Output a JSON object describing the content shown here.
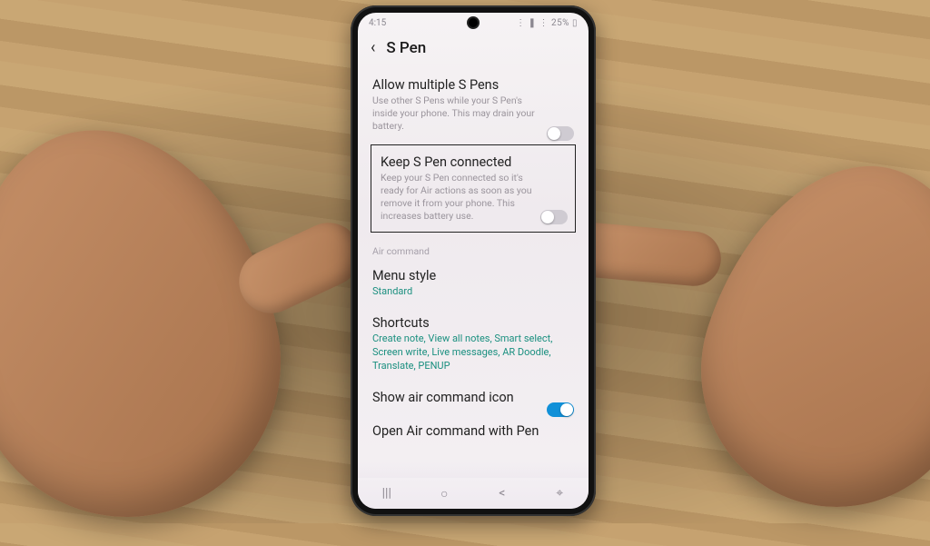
{
  "statusbar": {
    "time": "4:15",
    "right": "⋮ ❚ ⋮ 25% ▯"
  },
  "header": {
    "title": "S Pen"
  },
  "items": {
    "allow": {
      "title": "Allow multiple S Pens",
      "sub": "Use other S Pens while your S Pen's inside your phone. This may drain your battery."
    },
    "keep": {
      "title": "Keep S Pen connected",
      "sub": "Keep your S Pen connected so it's ready for Air actions as soon as you remove it from your phone. This increases battery use."
    },
    "section_air": "Air command",
    "menu": {
      "title": "Menu style",
      "value": "Standard"
    },
    "shortcuts": {
      "title": "Shortcuts",
      "value": "Create note, View all notes, Smart select, Screen write, Live messages, AR Doodle, Translate, PENUP"
    },
    "showicon": {
      "title": "Show air command icon"
    },
    "openair": {
      "title": "Open Air command with Pen"
    }
  },
  "nav": {
    "recents": "|||",
    "home": "○",
    "back": "<",
    "extra": "⌖"
  }
}
